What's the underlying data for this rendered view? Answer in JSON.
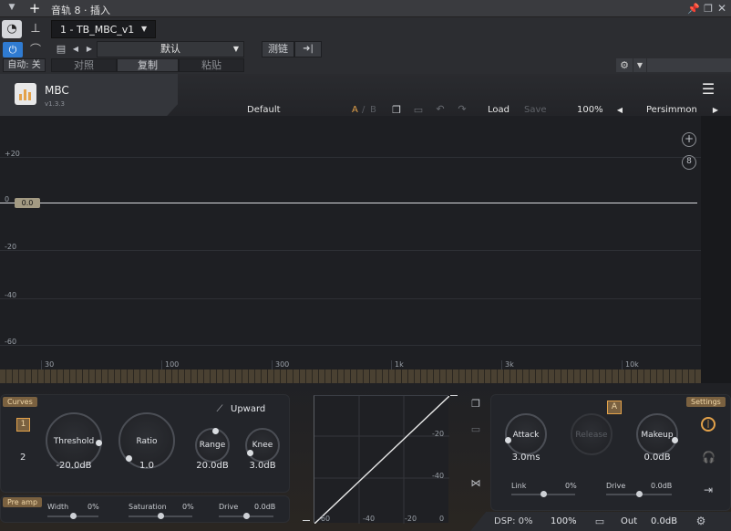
{
  "host": {
    "title": "音轨 8 · 插入",
    "track_name": "1 - TB_MBC_v1",
    "preset": "默认",
    "sidechain": "测链",
    "auto": "自动: 关",
    "compare": "对照",
    "copy": "复制",
    "paste": "粘贴"
  },
  "plugin": {
    "name": "MBC",
    "version": "v1.3.3",
    "preset": "Default",
    "ab_a": "A",
    "ab_sep": "/",
    "ab_b": "B",
    "load": "Load",
    "save": "Save",
    "zoom": "100%",
    "theme": "Persimmon"
  },
  "graph": {
    "db_labels": [
      "+20",
      "0",
      "-20",
      "-40",
      "-60"
    ],
    "freq_labels": [
      "30",
      "100",
      "300",
      "1k",
      "3k",
      "10k"
    ],
    "band_gain": "0.0"
  },
  "curves_panel": {
    "tag": "Curves",
    "band1": "1",
    "band2": "2",
    "mode": "Upward",
    "threshold": {
      "label": "Threshold",
      "value": "-20.0dB",
      "level": 0.85
    },
    "ratio": {
      "label": "Ratio",
      "value": "1.0",
      "level": 0.0
    },
    "range": {
      "label": "Range",
      "value": "20.0dB",
      "level": 0.55
    },
    "knee": {
      "label": "Knee",
      "value": "3.0dB",
      "level": 0.05
    }
  },
  "preamp": {
    "tag": "Pre amp",
    "width": {
      "label": "Width",
      "value": "0%",
      "level": 0.5
    },
    "saturation": {
      "label": "Saturation",
      "value": "0%",
      "level": 0.5
    },
    "drive": {
      "label": "Drive",
      "value": "0.0dB",
      "level": 0.5
    }
  },
  "transfer": {
    "y_labels": [
      "-20",
      "-40"
    ],
    "x_labels": [
      "-60",
      "-40",
      "-20",
      "0"
    ]
  },
  "dynamics": {
    "ab": "A",
    "attack": {
      "label": "Attack",
      "value": "3.0ms",
      "level": 0.1
    },
    "release": {
      "label": "Release",
      "value": ""
    },
    "makeup": {
      "label": "Makeup",
      "value": "0.0dB",
      "level": 0.9
    },
    "link": {
      "label": "Link",
      "value": "0%",
      "level": 0.5
    },
    "drive": {
      "label": "Drive",
      "value": "0.0dB",
      "level": 0.5
    },
    "settings": "Settings"
  },
  "status": {
    "dsp": "DSP: 0%",
    "zoom": "100%",
    "out_label": "Out",
    "out_value": "0.0dB"
  },
  "colors": {
    "accent": "#e3a24a",
    "tag_bg": "#7a6140",
    "blue": "#2f7bd2"
  }
}
